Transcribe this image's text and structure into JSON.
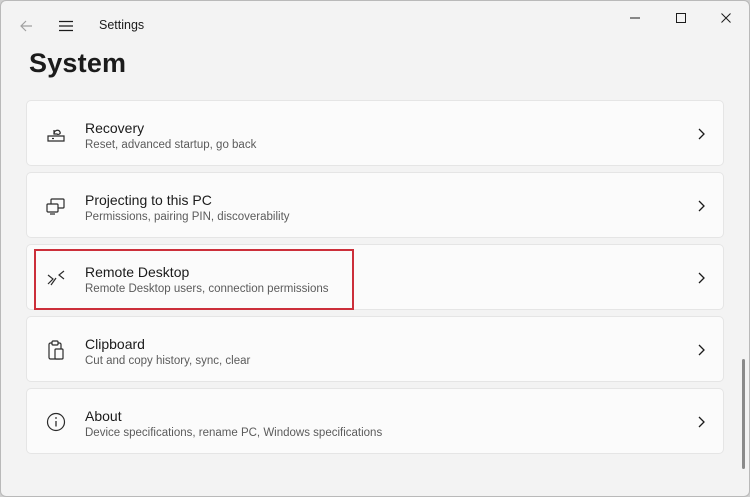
{
  "window": {
    "title": "Settings"
  },
  "page": {
    "title": "System"
  },
  "items": [
    {
      "label": "Recovery",
      "description": "Reset, advanced startup, go back",
      "icon": "recovery-icon"
    },
    {
      "label": "Projecting to this PC",
      "description": "Permissions, pairing PIN, discoverability",
      "icon": "projecting-icon"
    },
    {
      "label": "Remote Desktop",
      "description": "Remote Desktop users, connection permissions",
      "icon": "remote-desktop-icon"
    },
    {
      "label": "Clipboard",
      "description": "Cut and copy history, sync, clear",
      "icon": "clipboard-icon"
    },
    {
      "label": "About",
      "description": "Device specifications, rename PC, Windows specifications",
      "icon": "info-icon"
    }
  ],
  "colors": {
    "highlight": "#cc2f3a",
    "background": "#f3f3f3",
    "card": "#fbfbfb"
  }
}
